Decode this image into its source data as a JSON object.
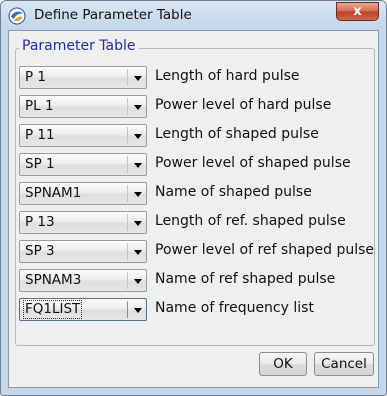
{
  "window": {
    "title": "Define Parameter Table",
    "close_glyph": "x",
    "app_icon": "bruker-app-icon"
  },
  "group": {
    "title": "Parameter Table"
  },
  "rows": [
    {
      "value": "P 1",
      "label": "Length of hard pulse"
    },
    {
      "value": "PL 1",
      "label": "Power level of hard pulse"
    },
    {
      "value": "P 11",
      "label": "Length of shaped pulse"
    },
    {
      "value": "SP 1",
      "label": "Power level of shaped pulse"
    },
    {
      "value": "SPNAM1",
      "label": "Name of shaped pulse"
    },
    {
      "value": "P 13",
      "label": "Length of ref. shaped pulse"
    },
    {
      "value": "SP 3",
      "label": "Power level of ref shaped pulse"
    },
    {
      "value": "SPNAM3",
      "label": "Name of ref shaped pulse"
    },
    {
      "value": "FQ1LIST",
      "label": "Name of frequency list"
    }
  ],
  "buttons": {
    "ok": "OK",
    "cancel": "Cancel"
  }
}
